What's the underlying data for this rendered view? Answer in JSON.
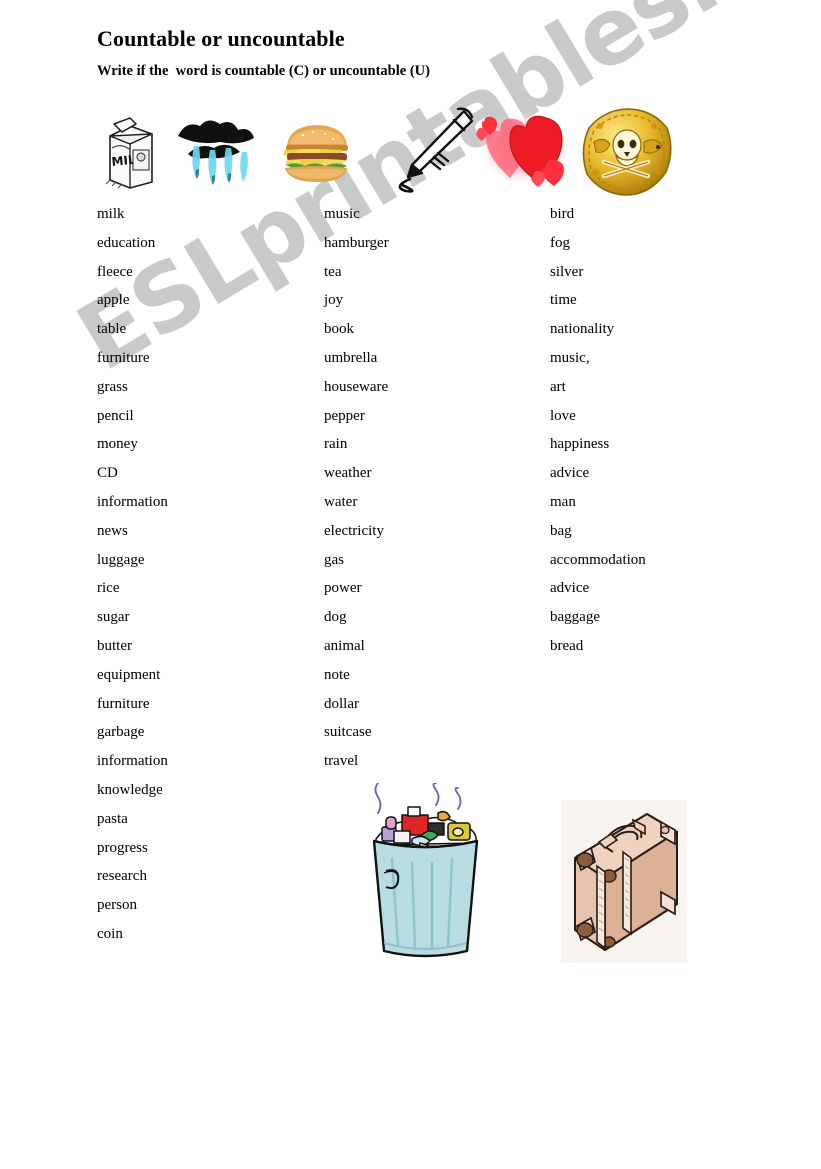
{
  "worksheet": {
    "title": "Countable or uncountable",
    "instruction": "Write if the  word is countable (C) or uncountable (U)",
    "watermark": "ESLprintables.com",
    "watermark_color": "#c9c9c9"
  },
  "illustrations": {
    "top_row": [
      {
        "name": "milk-carton-image",
        "label": "MILK"
      },
      {
        "name": "rain-cloud-image",
        "label": ""
      },
      {
        "name": "hamburger-image",
        "label": ""
      },
      {
        "name": "pencil-image",
        "label": ""
      },
      {
        "name": "heart-image",
        "label": ""
      },
      {
        "name": "gold-coin-image",
        "label": ""
      }
    ],
    "bottom_row": [
      {
        "name": "garbage-can-image",
        "label": ""
      },
      {
        "name": "suitcase-image",
        "label": ""
      }
    ]
  },
  "word_columns": [
    {
      "id": "column-1",
      "words": [
        "milk",
        "education",
        "fleece",
        "apple",
        "table",
        "furniture",
        "grass",
        "pencil",
        "money",
        "CD",
        "information",
        "news",
        "luggage",
        "rice",
        "sugar",
        "butter",
        "equipment",
        "furniture",
        "garbage",
        "information",
        "knowledge",
        "pasta",
        "progress",
        "research",
        "person",
        "coin"
      ]
    },
    {
      "id": "column-2",
      "words": [
        "music",
        "hamburger",
        "tea",
        "joy",
        "book",
        "umbrella",
        "houseware",
        "pepper",
        "rain",
        "weather",
        "water",
        "electricity",
        "gas",
        "power",
        "dog",
        "animal",
        "note",
        "dollar",
        "suitcase",
        "travel"
      ]
    },
    {
      "id": "column-3",
      "words": [
        "bird",
        "fog",
        "silver",
        "time",
        "nationality",
        "music,",
        "art",
        "love",
        "happiness",
        "advice",
        "man",
        "bag",
        "accommodation",
        "advice",
        "baggage",
        "bread"
      ]
    }
  ]
}
